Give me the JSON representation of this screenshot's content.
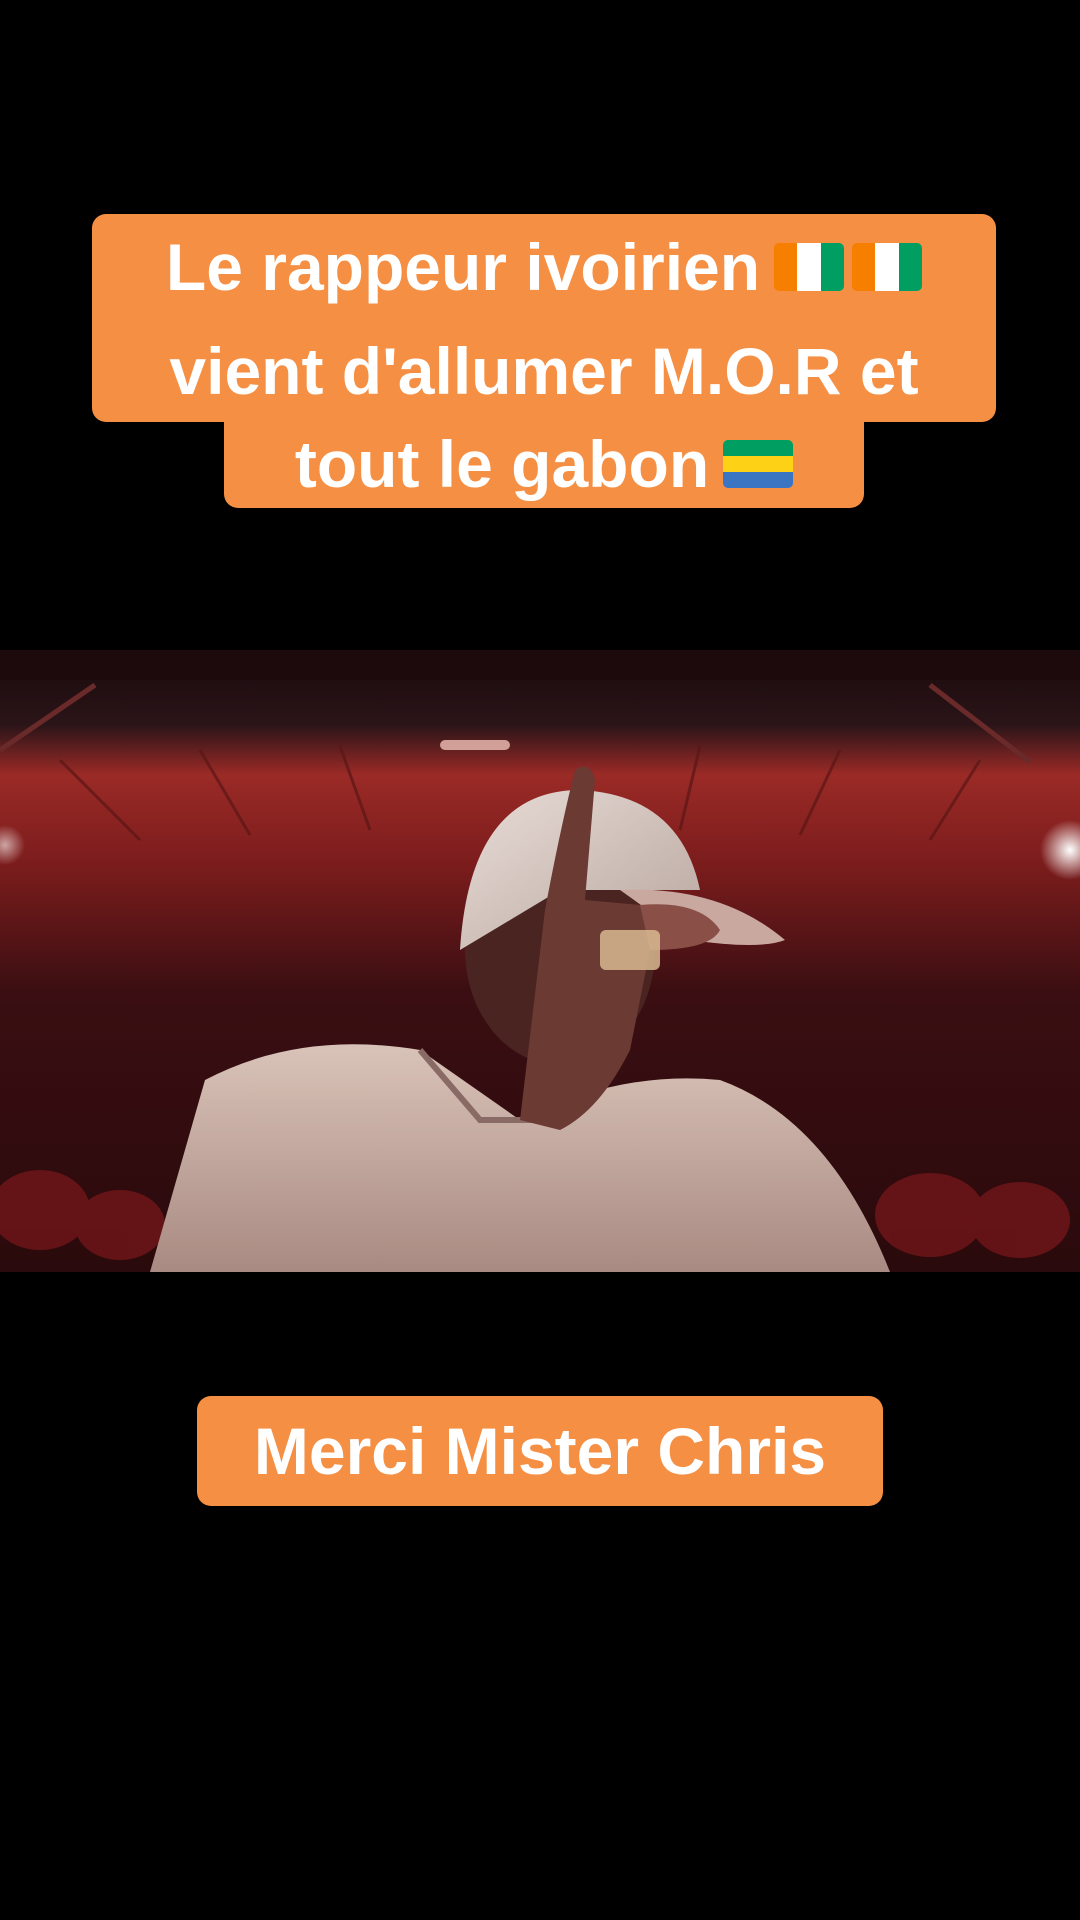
{
  "caption": {
    "line1": "Le rappeur ivoirien",
    "line2": "vient d'allumer M.O.R et",
    "line3": "tout le gabon",
    "line1_emoji": [
      "flag-cote-divoire-icon",
      "flag-cote-divoire-icon"
    ],
    "line3_emoji": [
      "flag-gabon-icon"
    ],
    "background_color": "#f58f43",
    "text_color": "#ffffff"
  },
  "bottom_caption": {
    "text": "Merci Mister Chris",
    "background_color": "#f58f43",
    "text_color": "#ffffff"
  },
  "video": {
    "scene": "music-video-frame",
    "dominant_color": "#7a1c1e"
  }
}
